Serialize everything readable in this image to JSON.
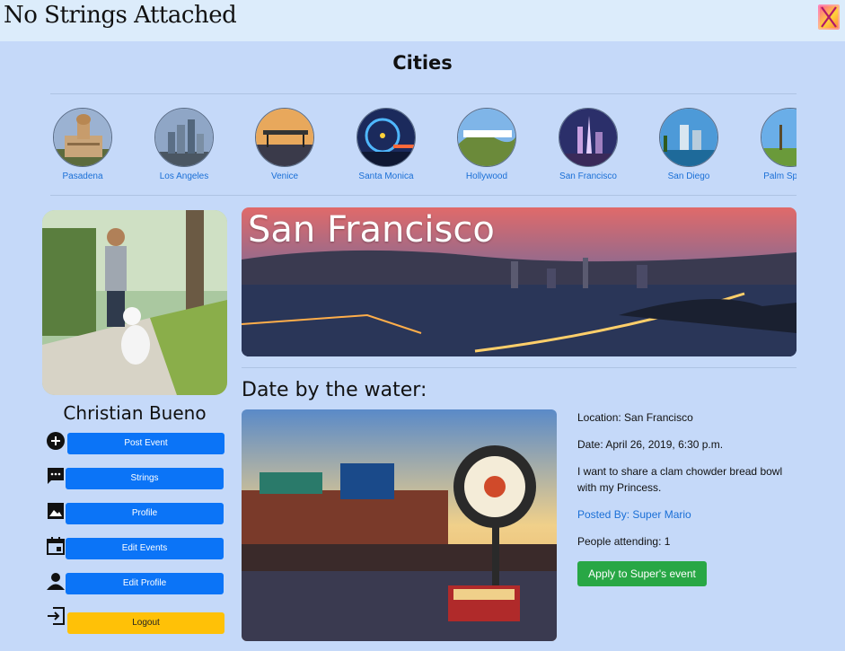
{
  "app": {
    "brand": "No Strings Attached",
    "logo_icon": "app-logo-icon"
  },
  "cities_section": {
    "title": "Cities",
    "items": [
      {
        "label": "Pasadena",
        "icon": "pasadena-photo"
      },
      {
        "label": "Los Angeles",
        "icon": "los-angeles-photo"
      },
      {
        "label": "Venice",
        "icon": "venice-photo"
      },
      {
        "label": "Santa Monica",
        "icon": "santa-monica-photo"
      },
      {
        "label": "Hollywood",
        "icon": "hollywood-photo"
      },
      {
        "label": "San Francisco",
        "icon": "san-francisco-photo"
      },
      {
        "label": "San Diego",
        "icon": "san-diego-photo"
      },
      {
        "label": "Palm Springs",
        "icon": "palm-springs-photo"
      }
    ]
  },
  "profile": {
    "name": "Christian Bueno",
    "menu": [
      {
        "label": "Post Event",
        "icon": "plus-circle-icon"
      },
      {
        "label": "Strings",
        "icon": "chat-bubble-icon"
      },
      {
        "label": "Profile",
        "icon": "image-icon"
      },
      {
        "label": "Edit Events",
        "icon": "calendar-icon"
      },
      {
        "label": "Edit Profile",
        "icon": "person-icon"
      },
      {
        "label": "Logout",
        "icon": "logout-icon"
      }
    ]
  },
  "city_hero": {
    "title": "San Francisco"
  },
  "event": {
    "title": "Date by the water:",
    "location": "Location: San Francisco",
    "date": "Date: April 26, 2019, 6:30 p.m.",
    "description": "I want to share a clam chowder bread bowl with my Princess.",
    "posted_by": "Posted By: Super Mario",
    "attending": "People attending: 1",
    "apply_label": "Apply to Super's event"
  },
  "colors": {
    "page_bg": "#c5d9f9",
    "topbar_bg": "#dcecfb",
    "primary": "#0b74f7",
    "warning": "#ffc107",
    "success": "#28a745",
    "link": "#1a6fd6"
  }
}
